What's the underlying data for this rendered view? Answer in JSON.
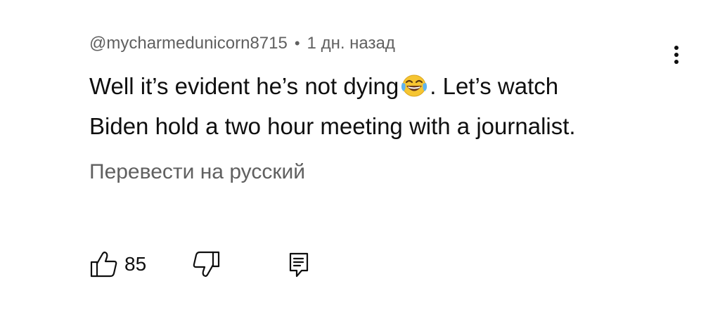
{
  "comment": {
    "author": "@mycharmedunicorn8715",
    "separator": "•",
    "timestamp": "1 дн. назад",
    "text_line1_part1": "Well it’s evident he’s not dying",
    "emoji": "face-with-tears-of-joy-emoji",
    "text_line1_part2": ".  Let’s watch",
    "text_line2": "Biden hold a two hour meeting with a journalist.",
    "translate_label": "Перевести на русский"
  },
  "actions": {
    "like_count": "85",
    "like_icon": "thumbs-up-icon",
    "dislike_icon": "thumbs-down-icon",
    "reply_icon": "reply-comment-icon",
    "more_icon": "more-vertical-icon"
  },
  "colors": {
    "primary_text": "#0f0f0f",
    "secondary_text": "#606060",
    "background": "#ffffff",
    "emoji_yellow": "#f6c531"
  }
}
